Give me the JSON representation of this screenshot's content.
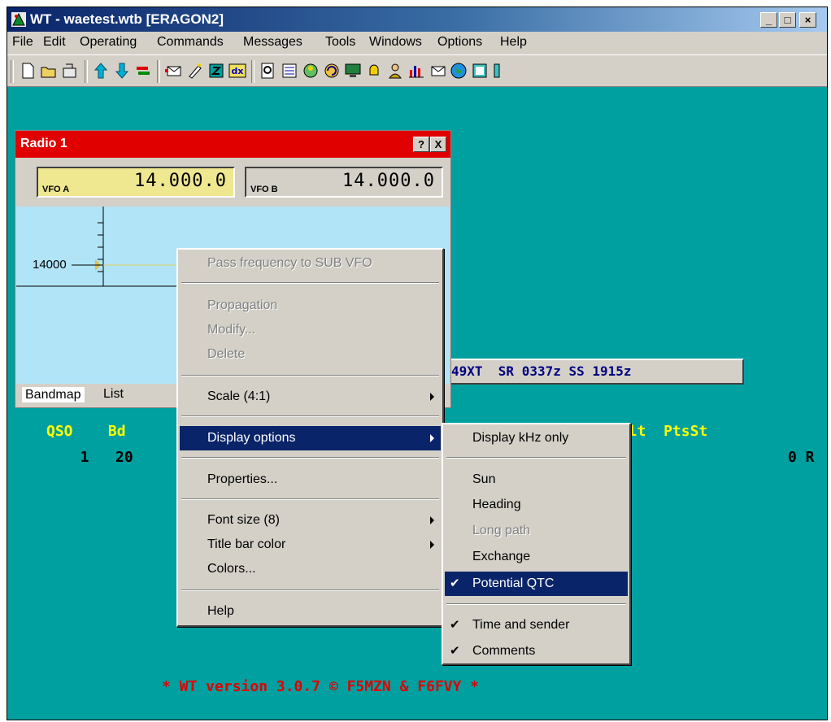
{
  "window": {
    "title": "WT - waetest.wtb [ERAGON2]"
  },
  "menubar": [
    "File",
    "Edit",
    "Operating",
    "Commands",
    "Messages",
    "Tools",
    "Windows",
    "Options",
    "Help"
  ],
  "toolbar_icons": [
    "new-file-icon",
    "open-folder-icon",
    "open-icon",
    "arrow-up-icon",
    "arrow-down-icon",
    "swap-icon",
    "envelope-icon",
    "sparkle-icon",
    "box-icon",
    "dx-icon",
    "search-doc-icon",
    "list-icon",
    "globe-pin-icon",
    "rotate-icon",
    "monitor-icon",
    "bell-icon",
    "person-icon",
    "bar-chart-icon",
    "mail-icon",
    "world-icon",
    "panel-icon"
  ],
  "toolbar_dx_label": "dx",
  "radio": {
    "title": "Radio 1",
    "help_btn": "?",
    "close_btn": "X",
    "vfo_a": {
      "label": "VFO A",
      "freq": "14.000.0"
    },
    "vfo_b": {
      "label": "VFO B",
      "freq": "14.000.0"
    },
    "scale_label": "14000",
    "tabs": [
      "Bandmap",
      "List"
    ]
  },
  "info_box": "49XT  SR 0337z SS 1915z",
  "log": {
    "header_left": "QSO    Bd",
    "header_right": "ent N°    Rcvd    Mult  PtsSt",
    "row_left": "  1   20",
    "row_right": "0 R",
    "footer": "* WT version 3.0.7 © F5MZN & F6FVY *"
  },
  "context_menu": {
    "items": {
      "pass_freq": "Pass frequency to SUB VFO",
      "propagation": "Propagation",
      "modify": "Modify...",
      "delete": "Delete",
      "scale": "Scale (4:1)",
      "display_options": "Display options",
      "properties": "Properties...",
      "font_size": "Font size (8)",
      "title_bar_color": "Title bar color",
      "colors": "Colors...",
      "help": "Help"
    }
  },
  "submenu": {
    "items": {
      "khz_only": "Display kHz only",
      "sun": "Sun",
      "heading": "Heading",
      "long_path": "Long path",
      "exchange": "Exchange",
      "potential_qtc": "Potential QTC",
      "time_sender": "Time and sender",
      "comments": "Comments"
    },
    "checked": [
      "Potential QTC",
      "Time and sender",
      "Comments"
    ]
  },
  "colors": {
    "teal": "#00a0a0",
    "yellow_text": "#ffff00",
    "red_text": "#e00000",
    "menu_highlight": "#0a246a",
    "radio_title": "#e00000"
  }
}
